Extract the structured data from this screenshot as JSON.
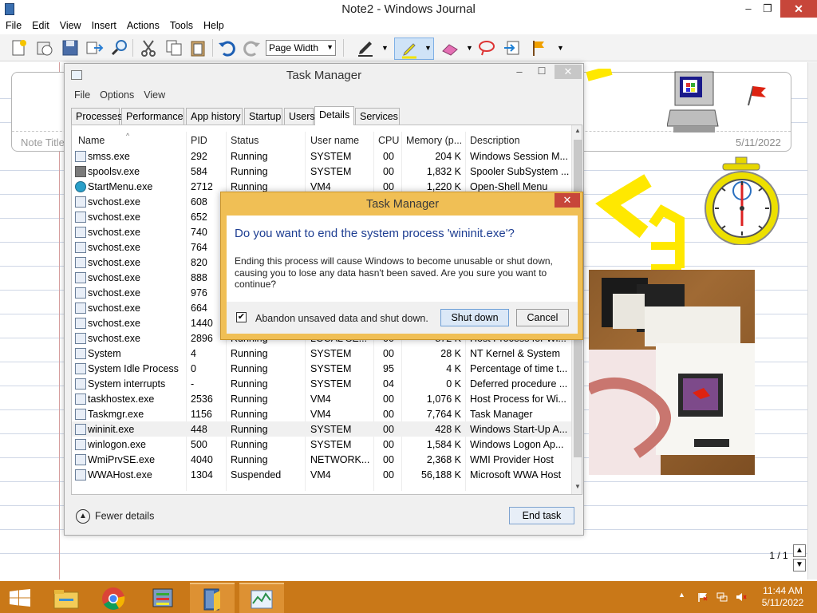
{
  "journal": {
    "title": "Note2 - Windows Journal",
    "controls": {
      "minimize": "–",
      "maximize": "❐",
      "close": "✕"
    },
    "menu": [
      "File",
      "Edit",
      "View",
      "Insert",
      "Actions",
      "Tools",
      "Help"
    ],
    "zoom_select": "Page Width",
    "note_title_placeholder": "Note Title",
    "note_date": "5/11/2022",
    "page_counter": "1 / 1"
  },
  "task_manager": {
    "title": "Task Manager",
    "controls": {
      "minimize": "–",
      "maximize": "☐",
      "close": "✕"
    },
    "menu": [
      "File",
      "Options",
      "View"
    ],
    "tabs": [
      "Processes",
      "Performance",
      "App history",
      "Startup",
      "Users",
      "Details",
      "Services"
    ],
    "active_tab": "Details",
    "columns": [
      "Name",
      "PID",
      "Status",
      "User name",
      "CPU",
      "Memory (p...",
      "Description"
    ],
    "rows": [
      {
        "name": "smss.exe",
        "pid": "292",
        "status": "Running",
        "user": "SYSTEM",
        "cpu": "00",
        "memory": "204 K",
        "description": "Windows Session M..."
      },
      {
        "name": "spoolsv.exe",
        "pid": "584",
        "status": "Running",
        "user": "SYSTEM",
        "cpu": "00",
        "memory": "1,832 K",
        "description": "Spooler SubSystem ..."
      },
      {
        "name": "StartMenu.exe",
        "pid": "2712",
        "status": "Running",
        "user": "VM4",
        "cpu": "00",
        "memory": "1,220 K",
        "description": "Open-Shell Menu"
      },
      {
        "name": "svchost.exe",
        "pid": "608",
        "status": "",
        "user": "",
        "cpu": "",
        "memory": "",
        "description": ""
      },
      {
        "name": "svchost.exe",
        "pid": "652",
        "status": "",
        "user": "",
        "cpu": "",
        "memory": "",
        "description": ""
      },
      {
        "name": "svchost.exe",
        "pid": "740",
        "status": "",
        "user": "",
        "cpu": "",
        "memory": "",
        "description": ""
      },
      {
        "name": "svchost.exe",
        "pid": "764",
        "status": "",
        "user": "",
        "cpu": "",
        "memory": "",
        "description": ""
      },
      {
        "name": "svchost.exe",
        "pid": "820",
        "status": "",
        "user": "",
        "cpu": "",
        "memory": "",
        "description": ""
      },
      {
        "name": "svchost.exe",
        "pid": "888",
        "status": "",
        "user": "",
        "cpu": "",
        "memory": "",
        "description": ""
      },
      {
        "name": "svchost.exe",
        "pid": "976",
        "status": "",
        "user": "",
        "cpu": "",
        "memory": "",
        "description": ""
      },
      {
        "name": "svchost.exe",
        "pid": "664",
        "status": "",
        "user": "",
        "cpu": "",
        "memory": "",
        "description": ""
      },
      {
        "name": "svchost.exe",
        "pid": "1440",
        "status": "",
        "user": "",
        "cpu": "",
        "memory": "",
        "description": ""
      },
      {
        "name": "svchost.exe",
        "pid": "2896",
        "status": "Running",
        "user": "LOCAL SE...",
        "cpu": "00",
        "memory": "872 K",
        "description": "Host Process for Wi..."
      },
      {
        "name": "System",
        "pid": "4",
        "status": "Running",
        "user": "SYSTEM",
        "cpu": "00",
        "memory": "28 K",
        "description": "NT Kernel & System"
      },
      {
        "name": "System Idle Process",
        "pid": "0",
        "status": "Running",
        "user": "SYSTEM",
        "cpu": "95",
        "memory": "4 K",
        "description": "Percentage of time t..."
      },
      {
        "name": "System interrupts",
        "pid": "-",
        "status": "Running",
        "user": "SYSTEM",
        "cpu": "04",
        "memory": "0 K",
        "description": "Deferred procedure ..."
      },
      {
        "name": "taskhostex.exe",
        "pid": "2536",
        "status": "Running",
        "user": "VM4",
        "cpu": "00",
        "memory": "1,076 K",
        "description": "Host Process for Wi..."
      },
      {
        "name": "Taskmgr.exe",
        "pid": "1156",
        "status": "Running",
        "user": "VM4",
        "cpu": "00",
        "memory": "7,764 K",
        "description": "Task Manager"
      },
      {
        "name": "wininit.exe",
        "pid": "448",
        "status": "Running",
        "user": "SYSTEM",
        "cpu": "00",
        "memory": "428 K",
        "description": "Windows Start-Up A..."
      },
      {
        "name": "winlogon.exe",
        "pid": "500",
        "status": "Running",
        "user": "SYSTEM",
        "cpu": "00",
        "memory": "1,584 K",
        "description": "Windows Logon Ap..."
      },
      {
        "name": "WmiPrvSE.exe",
        "pid": "4040",
        "status": "Running",
        "user": "NETWORK...",
        "cpu": "00",
        "memory": "2,368 K",
        "description": "WMI Provider Host"
      },
      {
        "name": "WWAHost.exe",
        "pid": "1304",
        "status": "Suspended",
        "user": "VM4",
        "cpu": "00",
        "memory": "56,188 K",
        "description": "Microsoft WWA Host"
      }
    ],
    "selected_row": "wininit.exe",
    "fewer_details": "Fewer details",
    "end_task": "End task"
  },
  "dialog": {
    "title": "Task Manager",
    "close": "✕",
    "heading": "Do you want to end the system process 'wininit.exe'?",
    "body": "Ending this process will cause Windows to become unusable or shut down, causing you to lose any data hasn't been saved. Are you sure you want to continue?",
    "checkbox_label": "Abandon unsaved data and shut down.",
    "checkbox_checked": true,
    "primary_button": "Shut down",
    "cancel_button": "Cancel"
  },
  "taskbar": {
    "time": "11:44 AM",
    "date": "5/11/2022",
    "apps": [
      "start-icon",
      "file-explorer-icon",
      "chrome-icon",
      "control-panel-icon",
      "journal-icon",
      "task-manager-icon"
    ]
  },
  "colors": {
    "taskbar": "#c97818",
    "dialog_frame": "#f0bf55",
    "dialog_heading": "#1e3e92",
    "highlighter": "#ffe800"
  }
}
